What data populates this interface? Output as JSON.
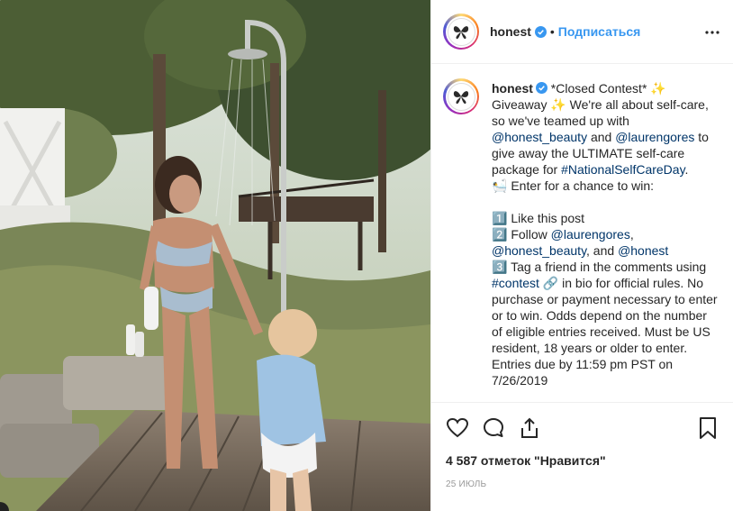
{
  "account": {
    "username": "honest",
    "follow_label": "Подписаться",
    "separator": "•",
    "verified_icon": "verified-badge-icon",
    "brand_color": "#3897f0"
  },
  "caption": {
    "username": "honest",
    "segments": [
      {
        "t": "text",
        "v": " *Closed Contest* ✨ Giveaway ✨ We're all about self-care, so we've teamed up with "
      },
      {
        "t": "link",
        "v": "@honest_beauty"
      },
      {
        "t": "text",
        "v": " and "
      },
      {
        "t": "link",
        "v": "@laurengores"
      },
      {
        "t": "text",
        "v": " to give away the ULTIMATE self-care package for "
      },
      {
        "t": "link",
        "v": "#NationalSelfCareDay"
      },
      {
        "t": "text",
        "v": ".\n🛀 Enter for a chance to win:\n\n1️⃣ Like this post\n2️⃣ Follow "
      },
      {
        "t": "link",
        "v": "@laurengores"
      },
      {
        "t": "text",
        "v": ",\n"
      },
      {
        "t": "link",
        "v": "@honest_beauty"
      },
      {
        "t": "text",
        "v": ", and "
      },
      {
        "t": "link",
        "v": "@honest"
      },
      {
        "t": "text",
        "v": "\n3️⃣ Tag a friend in the comments using "
      },
      {
        "t": "link",
        "v": "#contest"
      },
      {
        "t": "text",
        "v": " 🔗 in bio for official rules. No purchase or payment necessary to enter or to win. Odds depend on the number of eligible entries received. Must be US resident, 18 years or older to enter. Entries due by 11:59 pm PST on 7/26/2019"
      }
    ]
  },
  "actions": {
    "like_icon": "heart-icon",
    "comment_icon": "comment-icon",
    "share_icon": "share-icon",
    "save_icon": "bookmark-icon"
  },
  "likes_text": "4 587 отметок \"Нравится\"",
  "date_text": "25 июль"
}
